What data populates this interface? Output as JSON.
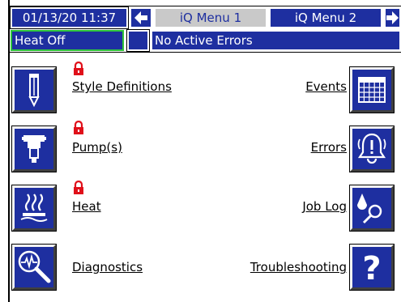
{
  "header": {
    "datetime": "01/13/20 11:37",
    "tabs": [
      {
        "label": "iQ Menu 1",
        "active": true
      },
      {
        "label": "iQ Menu 2",
        "active": false
      }
    ]
  },
  "status": {
    "heat": "Heat Off",
    "errors": "No Active Errors"
  },
  "menu": {
    "left": [
      {
        "label": "Style Definitions",
        "icon": "pencil-icon",
        "locked": true
      },
      {
        "label": "Pump(s)",
        "icon": "pump-icon",
        "locked": true
      },
      {
        "label": "Heat",
        "icon": "heat-icon",
        "locked": true
      },
      {
        "label": "Diagnostics",
        "icon": "magnifier-waveform-icon",
        "locked": false
      }
    ],
    "right": [
      {
        "label": "Events",
        "icon": "calendar-icon"
      },
      {
        "label": "Errors",
        "icon": "alarm-bell-icon"
      },
      {
        "label": "Job Log",
        "icon": "job-log-icon"
      },
      {
        "label": "Troubleshooting",
        "icon": "question-mark-icon"
      }
    ]
  },
  "colors": {
    "button_blue": "#1e2fa0",
    "active_tab": "#c9c9c9",
    "heat_status_border": "#2ec43a",
    "lock_red": "#e0101a"
  }
}
